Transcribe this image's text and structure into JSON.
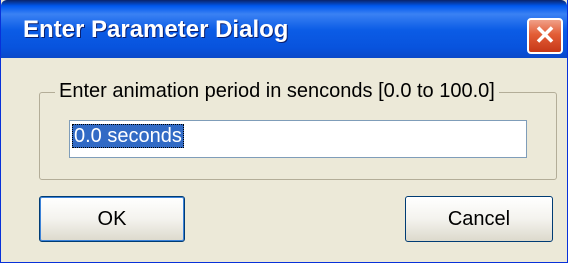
{
  "window": {
    "title": "Enter Parameter Dialog",
    "close_glyph": "✕"
  },
  "group": {
    "label": "Enter animation period in senconds [0.0 to 100.0]"
  },
  "input": {
    "value": "0.0 seconds"
  },
  "buttons": {
    "ok_label": "OK",
    "cancel_label": "Cancel"
  },
  "colors": {
    "titlebar": "#0853dd",
    "close_button": "#e35d36",
    "dialog_background": "#ece9d8",
    "selection": "#316ac5"
  }
}
